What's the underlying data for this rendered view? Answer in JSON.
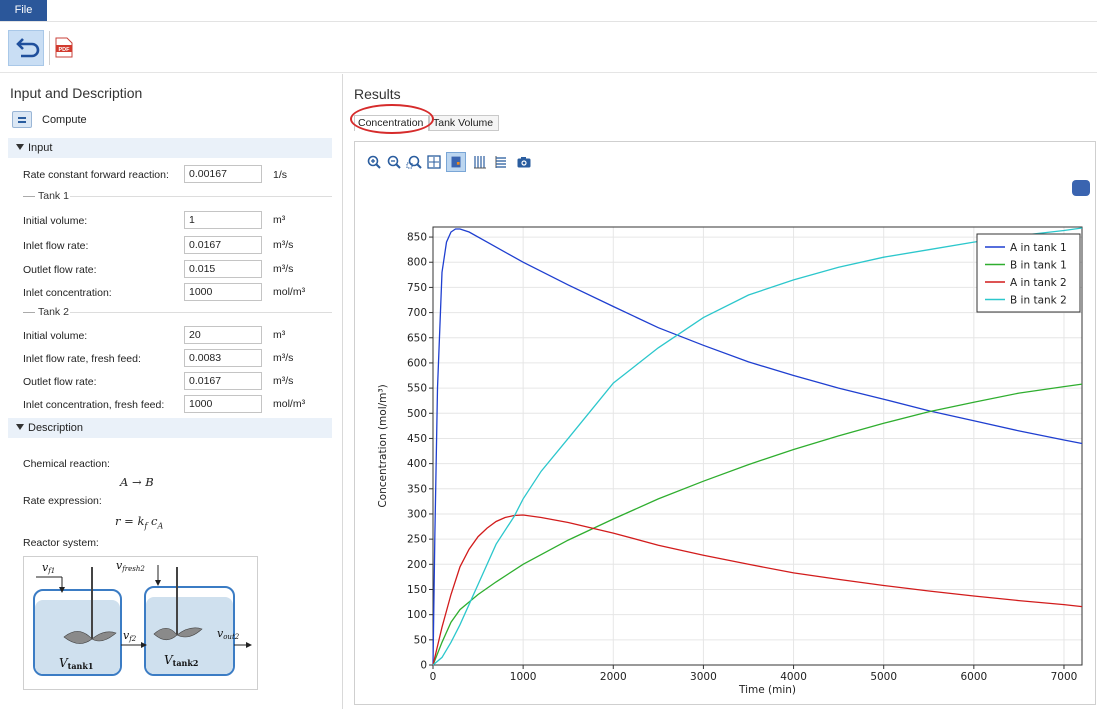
{
  "menu": {
    "file_label": "File"
  },
  "toolbar": {
    "undo_icon": "undo-icon",
    "pdf_icon": "pdf-icon"
  },
  "left_panel": {
    "title": "Input and Description",
    "compute_label": "Compute",
    "input_section": "Input",
    "rate_constant": {
      "label": "Rate constant forward reaction:",
      "value": "0.00167",
      "unit": "1/s"
    },
    "tank1": {
      "label": "Tank 1",
      "rows": [
        {
          "label": "Initial  volume:",
          "value": "1",
          "unit": "m³"
        },
        {
          "label": "Inlet flow rate:",
          "value": "0.0167",
          "unit": "m³/s"
        },
        {
          "label": "Outlet flow rate:",
          "value": "0.015",
          "unit": "m³/s"
        },
        {
          "label": "Inlet concentration:",
          "value": "1000",
          "unit": "mol/m³"
        }
      ]
    },
    "tank2": {
      "label": "Tank 2",
      "rows": [
        {
          "label": "Initial volume:",
          "value": "20",
          "unit": "m³"
        },
        {
          "label": "Inlet flow rate, fresh feed:",
          "value": "0.0083",
          "unit": "m³/s"
        },
        {
          "label": "Outlet flow rate:",
          "value": "0.0167",
          "unit": "m³/s"
        },
        {
          "label": "Inlet concentration, fresh feed:",
          "value": "1000",
          "unit": "mol/m³"
        }
      ]
    },
    "description_section": "Description",
    "chemical_reaction_label": "Chemical reaction:",
    "reaction_formula": "A → B",
    "rate_expression_label": "Rate expression:",
    "rate_formula": "r = kf cA",
    "reactor_system_label": "Reactor system:",
    "diagram": {
      "v_f1": "v",
      "v_f1_sub": "f1",
      "v_fresh2": "v",
      "v_fresh2_sub": "fresh2",
      "v_f2": "v",
      "v_f2_sub": "f2",
      "v_out2": "v",
      "v_out2_sub": "out2",
      "v_tank1": "V",
      "v_tank1_sub": "tank1",
      "v_tank2": "V",
      "v_tank2_sub": "tank2"
    }
  },
  "right_panel": {
    "title": "Results",
    "tabs": [
      {
        "label": "Concentration"
      },
      {
        "label": "Tank Volume"
      }
    ],
    "active_tab": "Concentration",
    "plot_tools": [
      "zoom-in-icon",
      "zoom-out-icon",
      "zoom-box-icon",
      "zoom-extents-icon",
      "scene-light-icon",
      "grid-icon",
      "table-icon",
      "camera-icon"
    ]
  },
  "colors": {
    "file_bg": "#2b579a",
    "a_tank1": "#1f3fd0",
    "b_tank1": "#2fae2f",
    "a_tank2": "#d21c1c",
    "b_tank2": "#2cc7cc",
    "annotation": "#d62b2b"
  },
  "chart_data": {
    "type": "line",
    "xlabel": "Time (min)",
    "ylabel": "Concentration (mol/m³)",
    "xlim": [
      0,
      7200
    ],
    "ylim": [
      0,
      870
    ],
    "xticks": [
      0,
      1000,
      2000,
      3000,
      4000,
      5000,
      6000,
      7000
    ],
    "yticks": [
      0,
      50,
      100,
      150,
      200,
      250,
      300,
      350,
      400,
      450,
      500,
      550,
      600,
      650,
      700,
      750,
      800,
      850
    ],
    "grid": true,
    "legend_position": "top-right",
    "series": [
      {
        "name": "A in tank 1",
        "color": "#1f3fd0",
        "x": [
          0,
          20,
          50,
          100,
          150,
          200,
          250,
          300,
          400,
          600,
          1000,
          1500,
          2000,
          2500,
          3000,
          3500,
          4000,
          4500,
          5000,
          5500,
          6000,
          6500,
          7000,
          7200
        ],
        "y": [
          0,
          250,
          550,
          780,
          840,
          860,
          866,
          866,
          860,
          840,
          800,
          755,
          712,
          670,
          635,
          602,
          575,
          550,
          528,
          505,
          485,
          465,
          447,
          440
        ]
      },
      {
        "name": "B in tank 1",
        "color": "#2fae2f",
        "x": [
          0,
          100,
          200,
          300,
          500,
          700,
          1000,
          1500,
          2000,
          2500,
          3000,
          3500,
          4000,
          4500,
          5000,
          5500,
          6000,
          6500,
          7000,
          7200
        ],
        "y": [
          0,
          45,
          85,
          110,
          140,
          165,
          200,
          248,
          290,
          330,
          365,
          398,
          428,
          455,
          480,
          503,
          522,
          540,
          553,
          558
        ]
      },
      {
        "name": "A in tank 2",
        "color": "#d21c1c",
        "x": [
          0,
          100,
          200,
          300,
          400,
          500,
          600,
          700,
          800,
          900,
          1000,
          1200,
          1500,
          2000,
          2500,
          3000,
          3500,
          4000,
          4500,
          5000,
          5500,
          6000,
          6500,
          7000,
          7200
        ],
        "y": [
          0,
          75,
          140,
          195,
          230,
          255,
          272,
          285,
          293,
          297,
          298,
          293,
          283,
          262,
          238,
          218,
          200,
          183,
          170,
          158,
          147,
          137,
          128,
          120,
          116
        ]
      },
      {
        "name": "B in tank 2",
        "color": "#2cc7cc",
        "x": [
          0,
          100,
          200,
          300,
          500,
          700,
          900,
          1000,
          1200,
          1500,
          2000,
          2500,
          3000,
          3500,
          4000,
          4500,
          5000,
          5500,
          6000,
          6500,
          7000,
          7200
        ],
        "y": [
          0,
          15,
          45,
          80,
          160,
          240,
          295,
          330,
          385,
          450,
          560,
          630,
          690,
          735,
          765,
          790,
          810,
          825,
          840,
          853,
          863,
          868
        ]
      }
    ]
  }
}
